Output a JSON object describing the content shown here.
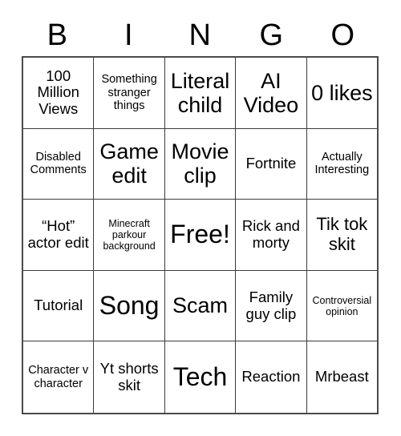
{
  "card": {
    "header": {
      "letters": [
        "B",
        "I",
        "N",
        "G",
        "O"
      ]
    },
    "rows": [
      [
        {
          "text": "100 Million Views",
          "size": "md"
        },
        {
          "text": "Something stranger things",
          "size": "sm"
        },
        {
          "text": "Literal child",
          "size": "xl"
        },
        {
          "text": "AI Video",
          "size": "xl"
        },
        {
          "text": "0 likes",
          "size": "xl"
        }
      ],
      [
        {
          "text": "Disabled Comments",
          "size": "sm"
        },
        {
          "text": "Game edit",
          "size": "xl"
        },
        {
          "text": "Movie clip",
          "size": "xl"
        },
        {
          "text": "Fortnite",
          "size": "md"
        },
        {
          "text": "Actually Interesting",
          "size": "sm"
        }
      ],
      [
        {
          "text": "“Hot” actor edit",
          "size": "md"
        },
        {
          "text": "Minecraft parkour background",
          "size": "xs"
        },
        {
          "text": "Free!",
          "size": "xxl"
        },
        {
          "text": "Rick and morty",
          "size": "md"
        },
        {
          "text": "Tik tok skit",
          "size": "lg"
        }
      ],
      [
        {
          "text": "Tutorial",
          "size": "md"
        },
        {
          "text": "Song",
          "size": "xxl"
        },
        {
          "text": "Scam",
          "size": "xl"
        },
        {
          "text": "Family guy clip",
          "size": "md"
        },
        {
          "text": "Controversial opinion",
          "size": "xs"
        }
      ],
      [
        {
          "text": "Character v character",
          "size": "sm"
        },
        {
          "text": "Yt shorts skit",
          "size": "md"
        },
        {
          "text": "Tech",
          "size": "xxl"
        },
        {
          "text": "Reaction",
          "size": "md"
        },
        {
          "text": "Mrbeast",
          "size": "md"
        }
      ]
    ]
  }
}
